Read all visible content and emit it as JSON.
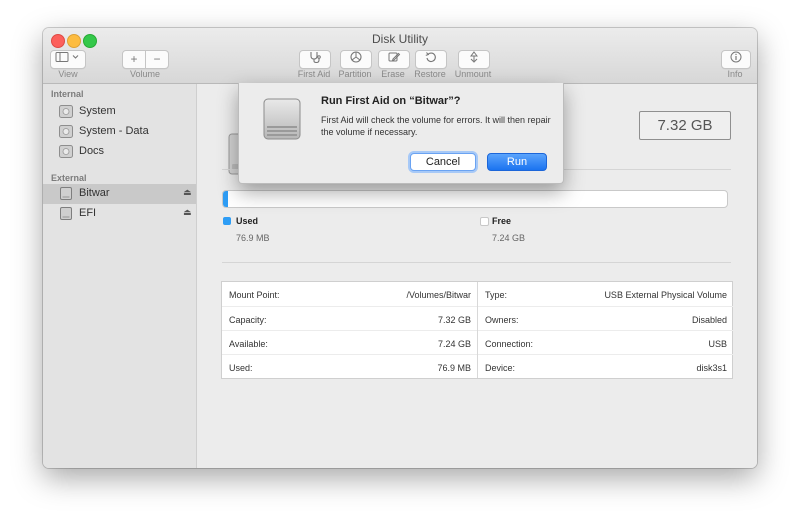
{
  "window": {
    "title": "Disk Utility"
  },
  "toolbar": {
    "view_label": "View",
    "volume_label": "Volume",
    "volume_add": "+",
    "volume_remove": "−",
    "first_aid_label": "First Aid",
    "partition_label": "Partition",
    "erase_label": "Erase",
    "restore_label": "Restore",
    "unmount_label": "Unmount",
    "info_label": "Info"
  },
  "sidebar": {
    "internal_header": "Internal",
    "external_header": "External",
    "internal_items": [
      {
        "label": "System"
      },
      {
        "label": "System - Data"
      },
      {
        "label": "Docs"
      }
    ],
    "external_items": [
      {
        "label": "Bitwar",
        "selected": true
      },
      {
        "label": "EFI",
        "selected": false
      }
    ]
  },
  "main": {
    "capacity_display": "7.32 GB",
    "usage": {
      "used_fraction": 0.0103,
      "used_title": "Used",
      "used_value": "76.9 MB",
      "free_title": "Free",
      "free_value": "7.24 GB",
      "used_color": "#2e9df5",
      "free_color": "#ffffff"
    },
    "info_left": [
      {
        "key": "Mount Point:",
        "value": "/Volumes/Bitwar"
      },
      {
        "key": "Capacity:",
        "value": "7.32 GB"
      },
      {
        "key": "Available:",
        "value": "7.24 GB"
      },
      {
        "key": "Used:",
        "value": "76.9 MB"
      }
    ],
    "info_right": [
      {
        "key": "Type:",
        "value": "USB External Physical Volume"
      },
      {
        "key": "Owners:",
        "value": "Disabled"
      },
      {
        "key": "Connection:",
        "value": "USB"
      },
      {
        "key": "Device:",
        "value": "disk3s1"
      }
    ]
  },
  "dialog": {
    "title": "Run First Aid on “Bitwar”?",
    "message": "First Aid will check the volume for errors. It will then repair the volume if necessary.",
    "cancel_label": "Cancel",
    "run_label": "Run"
  }
}
